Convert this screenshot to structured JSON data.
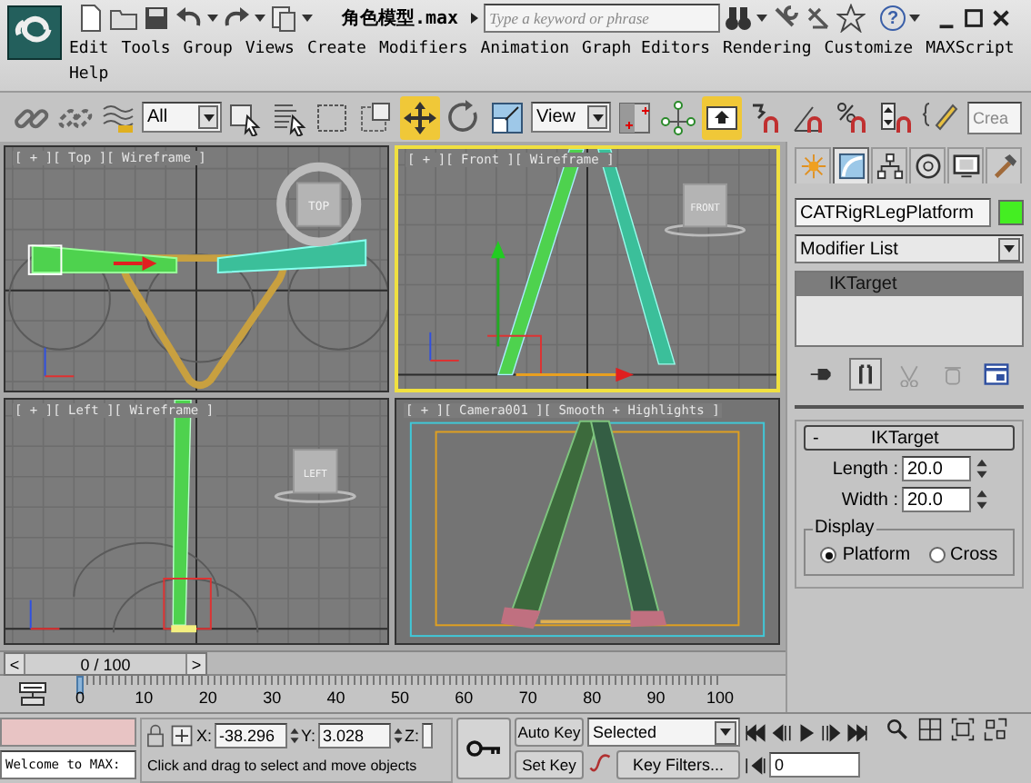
{
  "title_bar": {
    "file_name": "角色模型.max",
    "search": {
      "placeholder": "Type a keyword or phrase"
    },
    "help_glyph": "?"
  },
  "menu": [
    "Edit",
    "Tools",
    "Group",
    "Views",
    "Create",
    "Modifiers",
    "Animation",
    "Graph Editors",
    "Rendering",
    "Customize",
    "MAXScript",
    "Help"
  ],
  "toolbar": {
    "tools": [
      {
        "kind": "link",
        "selected": false
      },
      {
        "kind": "unlink",
        "selected": false
      },
      {
        "kind": "bind",
        "selected": false
      },
      {
        "kind": "dropdown",
        "value": "All"
      },
      {
        "kind": "select",
        "selected": false
      },
      {
        "kind": "select-by-name",
        "selected": false
      },
      {
        "kind": "region",
        "selected": false
      },
      {
        "kind": "crossing",
        "selected": false
      },
      {
        "kind": "move",
        "selected": true
      },
      {
        "kind": "rotate",
        "selected": false
      },
      {
        "kind": "scale",
        "selected": false
      },
      {
        "kind": "dropdown",
        "value": "View"
      },
      {
        "kind": "pivot",
        "selected": false
      },
      {
        "kind": "manipulate",
        "selected": false
      },
      {
        "kind": "override",
        "selected": true
      },
      {
        "kind": "snap",
        "selected": false
      },
      {
        "kind": "angle-snap",
        "selected": false
      },
      {
        "kind": "percent-snap",
        "selected": false
      },
      {
        "kind": "spinner-snap",
        "selected": false
      },
      {
        "kind": "named-sets",
        "selected": false
      },
      {
        "kind": "field",
        "placeholder": "Crea"
      }
    ]
  },
  "viewports": [
    {
      "kind": "top",
      "label": "[ + ][ Top ][ Wireframe ]",
      "cube": "TOP",
      "selected": false
    },
    {
      "kind": "front",
      "label": "[ + ][ Front ][ Wireframe ]",
      "cube": "FRONT",
      "selected": true
    },
    {
      "kind": "left",
      "label": "[ + ][ Left ][ Wireframe ]",
      "cube": "LEFT",
      "selected": false
    },
    {
      "kind": "camera",
      "label": "[ + ][ Camera001 ][ Smooth + Highlights ]",
      "selected": false
    }
  ],
  "command_panel": {
    "tabs": [
      {
        "kind": "create",
        "selected": false
      },
      {
        "kind": "modify",
        "selected": true
      },
      {
        "kind": "hierarchy",
        "selected": false
      },
      {
        "kind": "motion",
        "selected": false
      },
      {
        "kind": "display",
        "selected": false
      },
      {
        "kind": "utilities",
        "selected": false
      }
    ],
    "object_name": "CATRigRLegPlatform",
    "modifier_list": "Modifier List",
    "stack": [
      {
        "label": "IKTarget",
        "selected": true
      }
    ],
    "stack_tools": [
      {
        "kind": "pin",
        "selected": false,
        "disabled": false
      },
      {
        "kind": "end-result",
        "selected": true,
        "disabled": false
      },
      {
        "kind": "unique",
        "selected": false,
        "disabled": true
      },
      {
        "kind": "remove",
        "selected": false,
        "disabled": true
      },
      {
        "kind": "configure",
        "selected": false,
        "disabled": false
      }
    ],
    "rollout": {
      "sign": "-",
      "title": "IKTarget",
      "spinners": [
        {
          "label": "Length :",
          "value": "20.0"
        },
        {
          "label": "Width :",
          "value": "20.0"
        }
      ],
      "group": "Display",
      "radios": [
        {
          "label": "Platform",
          "selected": true
        },
        {
          "label": "Cross",
          "selected": false
        }
      ]
    }
  },
  "time_slider": {
    "prev": "<",
    "position": "0 / 100",
    "next": ">",
    "level": 0
  },
  "track_bar": {
    "ticks": [
      "0",
      "10",
      "20",
      "30",
      "40",
      "50",
      "60",
      "70",
      "80",
      "90",
      "100"
    ]
  },
  "status_bar": {
    "listener_output": "Welcome to MAX:",
    "coords": [
      {
        "label": "X:",
        "value": "-38.296"
      },
      {
        "label": "Y:",
        "value": "3.028"
      },
      {
        "label": "Z:"
      }
    ],
    "prompt": "Click and drag to select and move objects"
  },
  "animation": {
    "auto_key": "Auto Key",
    "set_key": "Set Key",
    "key_mode": "Selected",
    "key_filters": "Key Filters...",
    "current_frame": "0"
  }
}
